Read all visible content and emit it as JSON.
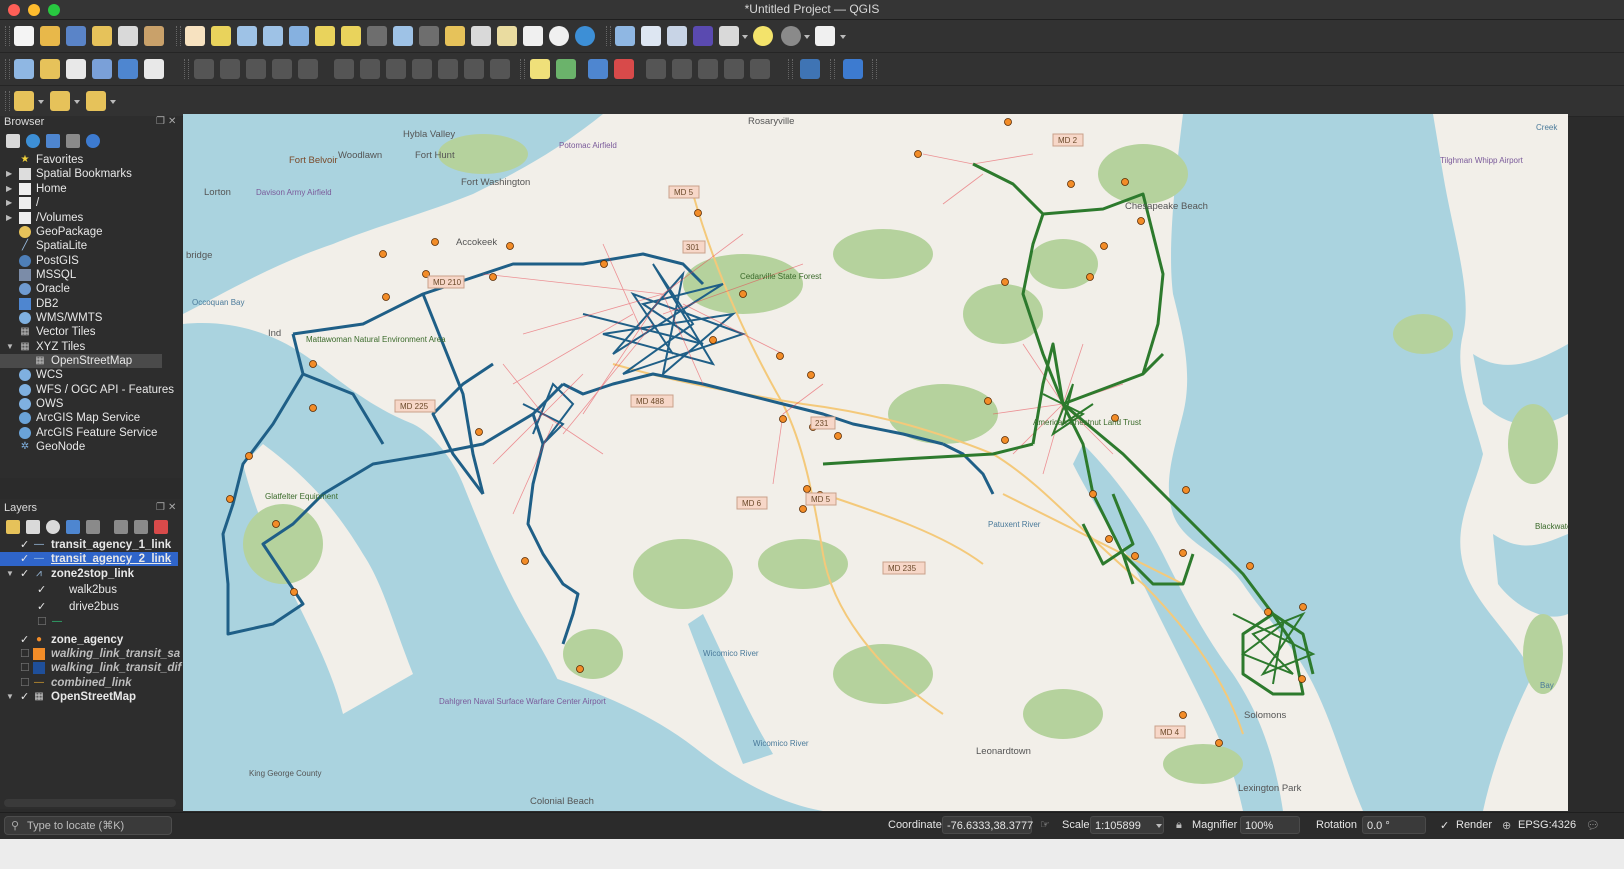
{
  "window": {
    "title": "*Untitled Project — QGIS"
  },
  "browser_panel": {
    "title": "Browser",
    "items": [
      {
        "label": "Favorites",
        "icon": "star-icon"
      },
      {
        "label": "Spatial Bookmarks",
        "icon": "bookmark-icon"
      },
      {
        "label": "Home",
        "icon": "home-icon"
      },
      {
        "label": "/",
        "icon": "folder-icon"
      },
      {
        "label": "/Volumes",
        "icon": "folder-icon"
      },
      {
        "label": "GeoPackage",
        "icon": "geopackage-icon"
      },
      {
        "label": "SpatiaLite",
        "icon": "spatialite-icon"
      },
      {
        "label": "PostGIS",
        "icon": "postgis-icon"
      },
      {
        "label": "MSSQL",
        "icon": "mssql-icon"
      },
      {
        "label": "Oracle",
        "icon": "oracle-icon"
      },
      {
        "label": "DB2",
        "icon": "db2-icon"
      },
      {
        "label": "WMS/WMTS",
        "icon": "wms-icon"
      },
      {
        "label": "Vector Tiles",
        "icon": "vector-tiles-icon"
      },
      {
        "label": "XYZ Tiles",
        "icon": "xyz-tiles-icon"
      },
      {
        "label": "OpenStreetMap",
        "icon": "osm-icon"
      },
      {
        "label": "WCS",
        "icon": "wcs-icon"
      },
      {
        "label": "WFS / OGC API - Features",
        "icon": "wfs-icon"
      },
      {
        "label": "OWS",
        "icon": "ows-icon"
      },
      {
        "label": "ArcGIS Map Service",
        "icon": "arcgis-icon"
      },
      {
        "label": "ArcGIS Feature Service",
        "icon": "arcgis-icon"
      },
      {
        "label": "GeoNode",
        "icon": "geonode-icon"
      }
    ]
  },
  "layers_panel": {
    "title": "Layers",
    "items": [
      {
        "label": "transit_agency_1_link",
        "checked": true
      },
      {
        "label": "transit_agency_2_link",
        "checked": true,
        "selected": true
      },
      {
        "label": "zone2stop_link",
        "checked": true
      },
      {
        "label": "walk2bus",
        "checked": true
      },
      {
        "label": "drive2bus",
        "checked": true
      },
      {
        "label": "",
        "checked": false
      },
      {
        "label": "zone_agency",
        "checked": true
      },
      {
        "label": "walking_link_transit_sa",
        "checked": false
      },
      {
        "label": "walking_link_transit_dif",
        "checked": false
      },
      {
        "label": "combined_link",
        "checked": false
      },
      {
        "label": "OpenStreetMap",
        "checked": true
      }
    ]
  },
  "map_labels": {
    "rosaryville": "Rosaryville",
    "hybla_valley": "Hybla Valley",
    "potomac_airfield": "Potomac Airfield",
    "md2": "MD 2",
    "tilghman": "Tilghman Whipp Airport",
    "woodlawn": "Woodlawn",
    "fort_hunt": "Fort Hunt",
    "fort_belvoir": "Fort Belvoir",
    "lorton": "Lorton",
    "davison": "Davison Army Airfield",
    "fort_washington": "Fort Washington",
    "md5_top": "MD 5",
    "chesapeake": "Chesapeake Beach",
    "accokeek": "Accokeek",
    "md301": "301",
    "cedarville": "Cedarville State Forest",
    "md210": "MD 210",
    "bridge": "bridge",
    "occoquan": "Occoquan Bay",
    "indian_head": "Ind",
    "mattawoman": "Mattawoman Natural Environment Area",
    "md225": "MD 225",
    "md488": "MD 488",
    "md231": "231",
    "american_chestnut": "American Chestnut Land Trust",
    "md6": "MD 6",
    "md5_mid": "MD 5",
    "glatfelter": "Glatfelter Equipment",
    "patuxent": "Patuxent River",
    "md235": "MD 235",
    "wicomico1": "Wicomico River",
    "dahlgren": "Dahlgren Naval Surface Warfare Center Airport",
    "wicomico2": "Wicomico River",
    "solomons": "Solomons",
    "md4": "MD 4",
    "leonardtown": "Leonardtown",
    "king_george": "King George County",
    "colonial_beach": "Colonial Beach",
    "lexington_park": "Lexington Park",
    "bay": "Bay",
    "blackwater": "Blackwater",
    "creek": "Creek"
  },
  "statusbar": {
    "locate_placeholder": "Type to locate (⌘K)",
    "coordinate_label": "Coordinate",
    "coordinate_value": "-76.6333,38.3777",
    "scale_label": "Scale",
    "scale_value": "1:105899",
    "magnifier_label": "Magnifier",
    "magnifier_value": "100%",
    "rotation_label": "Rotation",
    "rotation_value": "0.0 °",
    "render_label": "Render",
    "crs_label": "EPSG:4326"
  },
  "colors": {
    "agency1_link": "#1f5f87",
    "agency2_link": "#2d7a2d",
    "zone2stop": "#e8434f",
    "zone_node": "#f28c28",
    "selection": "#2f65ca",
    "water": "#aad3df",
    "land": "#f2efe9",
    "forest": "#b5d29d"
  }
}
